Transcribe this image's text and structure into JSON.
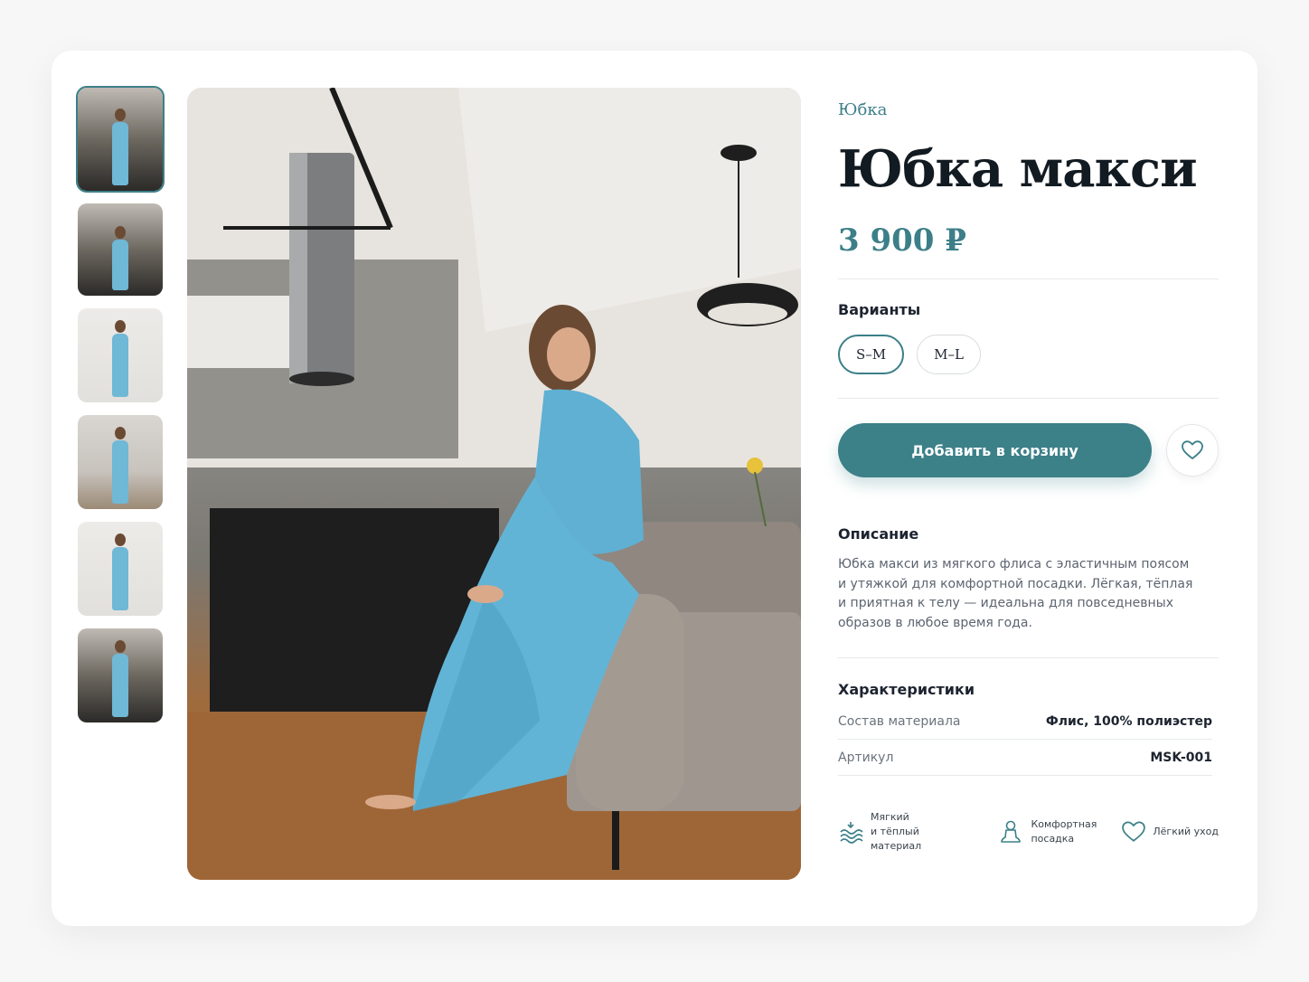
{
  "product": {
    "category": "Юбка",
    "title": "Юбка макси",
    "price": "3 900 ₽"
  },
  "variants": {
    "label": "Варианты",
    "options": [
      "S–M",
      "M–L"
    ],
    "selected": "S–M"
  },
  "actions": {
    "add_to_cart": "Добавить в корзину"
  },
  "description": {
    "title": "Описание",
    "text": "Юбка макси из мягкого флиса с эластичным поясом и утяжкой для комфортной посадки. Лёгкая, тёплая и приятная к телу — идеальна для повседневных образов в любое время года."
  },
  "specs": {
    "title": "Характеристики",
    "rows": [
      {
        "key": "Состав материала",
        "value": "Флис, 100% полиэстер"
      },
      {
        "key": "Артикул",
        "value": "MSK-001"
      }
    ]
  },
  "features": [
    {
      "icon": "soft-material-icon",
      "line1": "Мягкий",
      "line2": "и тёплый материал"
    },
    {
      "icon": "comfort-fit-icon",
      "line1": "Комфортная",
      "line2": "посадка"
    },
    {
      "icon": "heart-icon",
      "line1": "Лёгкий уход",
      "line2": ""
    }
  ],
  "colors": {
    "accent": "#3c8088",
    "text": "#131b22",
    "muted": "#5c6470"
  }
}
